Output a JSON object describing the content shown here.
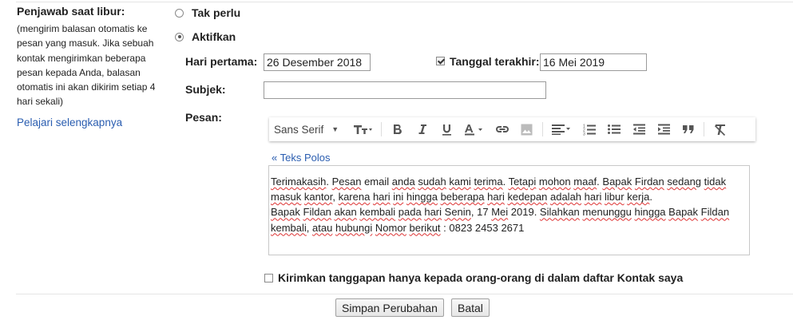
{
  "vacation": {
    "title": "Penjawab saat libur:",
    "description": "(mengirim balasan otomatis ke pesan yang masuk. Jika sebuah kontak mengirimkan beberapa pesan kepada Anda, balasan otomatis ini akan dikirim setiap 4 hari sekali)",
    "learn_more": "Pelajari selengkapnya",
    "option_off": "Tak perlu",
    "option_on": "Aktifkan",
    "first_day_label": "Hari pertama:",
    "first_day_value": "26 Desember 2018",
    "last_day_label": "Tanggal terakhir:",
    "last_day_value": "16 Mei 2019",
    "subject_label": "Subjek:",
    "subject_value": "",
    "message_label": "Pesan:",
    "font_name": "Sans Serif",
    "plain_text_link": "« Teks Polos",
    "message_line1_parts": [
      "Terimakasih",
      ". ",
      "Pesan",
      " email ",
      "anda",
      " ",
      "sudah",
      " ",
      "kami",
      " ",
      "terima",
      ". ",
      "Tetapi",
      " ",
      "mohon",
      " ",
      "maaf",
      ". ",
      "Bapak",
      " ",
      "Firdan",
      " ",
      "sedang",
      " ",
      "tidak"
    ],
    "message_line2_parts": [
      "masuk",
      " ",
      "kantor",
      ", ",
      "karena",
      " ",
      "hari",
      " ",
      "ini",
      " ",
      "hingga",
      " ",
      "beberapa",
      " ",
      "hari",
      " ",
      "kedepan",
      " ",
      "adalah",
      " ",
      "hari",
      " ",
      "libur",
      " ",
      "kerja",
      "."
    ],
    "message_line3_parts": [
      "Bapak",
      " ",
      "Fildan",
      " ",
      "akan",
      " ",
      "kembali",
      " ",
      "pada",
      " ",
      "hari",
      " ",
      "Senin",
      ", 17 ",
      "Mei",
      " 2019. ",
      "Silahkan",
      " ",
      "menunggu",
      " ",
      "hingga",
      " ",
      "Bapak",
      " ",
      "Fildan"
    ],
    "message_line4_parts": [
      "kembali",
      ", ",
      "atau",
      " ",
      "hubungi",
      " ",
      "Nomor",
      " ",
      "berikut",
      " : 0823 2453 2671"
    ],
    "contacts_only_label": "Kirimkan tanggapan hanya kepada orang-orang di dalam daftar Kontak saya",
    "save_button": "Simpan Perubahan",
    "cancel_button": "Batal"
  },
  "state": {
    "selected_option": "on",
    "last_day_checked": true,
    "contacts_only_checked": false
  },
  "colors": {
    "link": "#2a5db0",
    "spellcheck": "#d33"
  }
}
